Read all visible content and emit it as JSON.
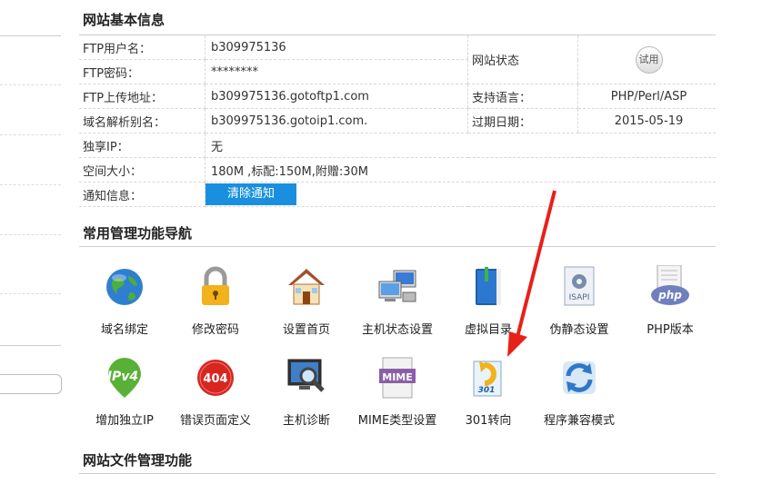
{
  "info_section": {
    "title": "网站基本信息",
    "rows": [
      {
        "label": "FTP用户名：",
        "value": "b309975136"
      },
      {
        "label": "FTP密码：",
        "value": "********"
      },
      {
        "label": "FTP上传地址：",
        "value": "b309975136.gotoftp1.com"
      },
      {
        "label": "域名解析别名：",
        "value": "b309975136.gotoip1.com."
      },
      {
        "label": "独享IP：",
        "value": "无"
      },
      {
        "label": "空间大小：",
        "value": "180M ,标配:150M,附赠:30M"
      },
      {
        "label": "通知信息：",
        "button": "清除通知"
      }
    ],
    "site_status_label": "网站状态",
    "site_status_button": "试用",
    "language_label": "支持语言：",
    "language_value": "PHP/Perl/ASP",
    "expire_label": "过期日期：",
    "expire_value": "2015-05-19"
  },
  "nav_section": {
    "title": "常用管理功能导航",
    "row1": [
      "域名绑定",
      "修改密码",
      "设置首页",
      "主机状态设置",
      "虚拟目录",
      "伪静态设置",
      "PHP版本"
    ],
    "row2": [
      "增加独立IP",
      "错误页面定义",
      "主机诊断",
      "MIME类型设置",
      "301转向",
      "程序兼容模式"
    ],
    "icons": {
      "isapi_text": "ISAPI",
      "php_text": "php",
      "ipv4_text": "IPv4",
      "err_text": "404",
      "mime_text": "MIME",
      "redirect_text": "301"
    }
  },
  "files_section": {
    "title": "网站文件管理功能"
  },
  "colors": {
    "accent": "#1a8fe0",
    "arrow": "#e8201a"
  }
}
